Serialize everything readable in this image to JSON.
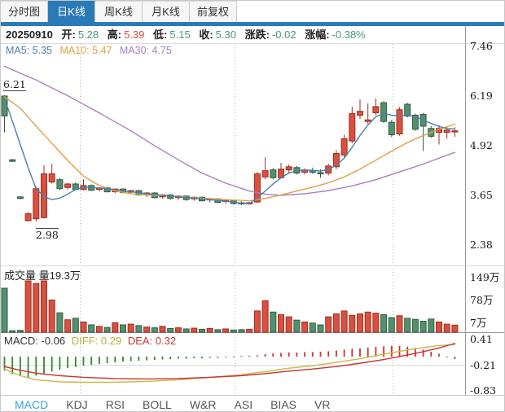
{
  "top_tabs": {
    "items": [
      {
        "label": "分时图",
        "selected": false
      },
      {
        "label": "日K线",
        "selected": true
      },
      {
        "label": "周K线",
        "selected": false
      },
      {
        "label": "月K线",
        "selected": false
      },
      {
        "label": "前复权",
        "selected": false
      }
    ]
  },
  "header": {
    "date": "20250910",
    "fields": [
      {
        "label": "开:",
        "value": "5.28",
        "color": "#459a80"
      },
      {
        "label": "高:",
        "value": "5.39",
        "color": "#e2493d"
      },
      {
        "label": "低:",
        "value": "5.15",
        "color": "#459a80"
      },
      {
        "label": "收:",
        "value": "5.30",
        "color": "#459a80"
      },
      {
        "label": "涨跌:",
        "value": "-0.02",
        "color": "#459a80"
      },
      {
        "label": "涨幅:",
        "value": "-0.38%",
        "color": "#459a80"
      }
    ]
  },
  "ma_row": {
    "items": [
      {
        "text": "MA5: 5.35",
        "color": "#4d7fad"
      },
      {
        "text": "MA10: 5.47",
        "color": "#e2a043"
      },
      {
        "text": "MA30: 4.75",
        "color": "#ab7fc0"
      }
    ]
  },
  "volume_panel": {
    "label": "成交量 量19.3万",
    "ticks": [
      "149万",
      "78万",
      "7万"
    ]
  },
  "macd_panel": {
    "items": [
      {
        "text": "MACD: -0.06",
        "color": "#333333"
      },
      {
        "text": "DIFF: 0.29",
        "color": "#bdae3e"
      },
      {
        "text": "DEA: 0.32",
        "color": "#cc3333"
      }
    ],
    "ticks": [
      "0.41",
      "-0.21",
      "-0.83"
    ]
  },
  "bottom_tabs": {
    "items": [
      "MACD",
      "KDJ",
      "RSI",
      "BOLL",
      "W&R",
      "ASI",
      "BIAS",
      "VR"
    ],
    "selected": 0
  },
  "chart_data": {
    "type": "candlestick",
    "title": "日K线 20250910",
    "price_axis": {
      "ticks": [
        "7.46",
        "6.19",
        "4.92",
        "3.65",
        "2.38"
      ],
      "values": [
        7.46,
        6.19,
        4.92,
        3.65,
        2.38
      ]
    },
    "annotations": {
      "high": "6.21",
      "low": "2.98"
    },
    "grid_x": [
      97,
      287,
      481
    ],
    "candles": [
      [
        6.19,
        6.21,
        5.26,
        5.68
      ],
      [
        4.56,
        4.58,
        4.5,
        4.52
      ],
      [
        3.61,
        3.63,
        3.55,
        3.57
      ],
      [
        3.0,
        3.22,
        2.98,
        3.18
      ],
      [
        3.05,
        3.88,
        2.98,
        3.82
      ],
      [
        3.08,
        4.42,
        3.05,
        4.2
      ],
      [
        3.99,
        4.46,
        3.95,
        4.2
      ],
      [
        4.05,
        4.1,
        3.78,
        3.82
      ],
      [
        3.85,
        3.97,
        3.8,
        3.94
      ],
      [
        3.94,
        3.98,
        3.78,
        3.8
      ],
      [
        3.8,
        4.06,
        3.78,
        3.9
      ],
      [
        3.9,
        3.93,
        3.76,
        3.78
      ],
      [
        3.8,
        3.86,
        3.75,
        3.84
      ],
      [
        3.84,
        3.87,
        3.72,
        3.74
      ],
      [
        3.74,
        3.83,
        3.71,
        3.81
      ],
      [
        3.81,
        3.83,
        3.7,
        3.72
      ],
      [
        3.73,
        3.79,
        3.68,
        3.77
      ],
      [
        3.77,
        3.79,
        3.64,
        3.66
      ],
      [
        3.68,
        3.73,
        3.6,
        3.71
      ],
      [
        3.71,
        3.73,
        3.57,
        3.59
      ],
      [
        3.61,
        3.68,
        3.57,
        3.66
      ],
      [
        3.66,
        3.68,
        3.54,
        3.57
      ],
      [
        3.59,
        3.65,
        3.53,
        3.63
      ],
      [
        3.63,
        3.65,
        3.51,
        3.54
      ],
      [
        3.56,
        3.62,
        3.51,
        3.6
      ],
      [
        3.6,
        3.62,
        3.49,
        3.51
      ],
      [
        3.53,
        3.58,
        3.47,
        3.56
      ],
      [
        3.56,
        3.58,
        3.45,
        3.47
      ],
      [
        3.49,
        3.54,
        3.43,
        3.52
      ],
      [
        3.52,
        3.54,
        3.41,
        3.44
      ],
      [
        3.46,
        3.5,
        3.4,
        3.43
      ],
      [
        3.44,
        3.48,
        3.41,
        3.46
      ],
      [
        3.48,
        4.25,
        3.45,
        4.2
      ],
      [
        4.12,
        4.62,
        4.06,
        4.28
      ],
      [
        4.3,
        4.35,
        4.06,
        4.1
      ],
      [
        4.1,
        4.48,
        4.08,
        4.32
      ],
      [
        4.3,
        4.44,
        4.22,
        4.38
      ],
      [
        4.36,
        4.4,
        4.18,
        4.22
      ],
      [
        4.24,
        4.34,
        4.18,
        4.3
      ],
      [
        4.28,
        4.36,
        4.2,
        4.24
      ],
      [
        4.23,
        4.32,
        4.1,
        4.2
      ],
      [
        4.22,
        4.46,
        4.16,
        4.4
      ],
      [
        4.38,
        4.8,
        4.32,
        4.72
      ],
      [
        4.68,
        5.2,
        4.62,
        5.1
      ],
      [
        5.04,
        5.92,
        4.98,
        5.74
      ],
      [
        5.7,
        6.1,
        5.6,
        5.8
      ],
      [
        5.54,
        6.0,
        5.48,
        5.58
      ],
      [
        5.76,
        6.13,
        5.7,
        5.92
      ],
      [
        6.02,
        6.06,
        5.5,
        5.54
      ],
      [
        5.52,
        5.58,
        5.14,
        5.2
      ],
      [
        5.22,
        5.9,
        5.18,
        5.84
      ],
      [
        5.98,
        6.02,
        5.64,
        5.68
      ],
      [
        5.7,
        5.74,
        5.3,
        5.34
      ],
      [
        5.72,
        5.76,
        4.78,
        5.42
      ],
      [
        5.36,
        5.42,
        5.12,
        5.16
      ],
      [
        5.26,
        5.45,
        4.95,
        5.36
      ],
      [
        5.26,
        5.42,
        5.1,
        5.32
      ],
      [
        5.28,
        5.39,
        5.15,
        5.3
      ]
    ],
    "volumes": [
      120,
      4,
      5,
      140,
      133,
      140,
      88,
      53,
      34,
      38,
      28,
      20,
      16,
      13,
      26,
      20,
      22,
      18,
      14,
      12,
      16,
      10,
      12,
      9,
      11,
      8,
      10,
      7,
      9,
      6,
      7,
      8,
      58,
      86,
      55,
      48,
      42,
      33,
      28,
      25,
      20,
      42,
      50,
      58,
      46,
      50,
      55,
      52,
      48,
      40,
      45,
      38,
      35,
      30,
      36,
      28,
      22,
      19.3
    ],
    "ma5_points": [
      [
        0,
        6.13
      ],
      [
        1,
        5.55
      ],
      [
        2,
        4.95
      ],
      [
        3,
        4.35
      ],
      [
        4,
        3.82
      ],
      [
        5,
        3.62
      ],
      [
        6,
        3.54
      ],
      [
        7,
        3.58
      ],
      [
        8,
        3.68
      ],
      [
        9,
        3.8
      ],
      [
        10,
        3.86
      ],
      [
        12,
        3.84
      ],
      [
        14,
        3.8
      ],
      [
        16,
        3.74
      ],
      [
        18,
        3.69
      ],
      [
        20,
        3.65
      ],
      [
        22,
        3.61
      ],
      [
        24,
        3.58
      ],
      [
        26,
        3.54
      ],
      [
        28,
        3.5
      ],
      [
        30,
        3.45
      ],
      [
        31,
        3.44
      ],
      [
        32,
        3.58
      ],
      [
        33,
        3.76
      ],
      [
        34,
        3.94
      ],
      [
        35,
        4.1
      ],
      [
        36,
        4.22
      ],
      [
        37,
        4.28
      ],
      [
        38,
        4.3
      ],
      [
        39,
        4.29
      ],
      [
        40,
        4.27
      ],
      [
        41,
        4.31
      ],
      [
        42,
        4.42
      ],
      [
        43,
        4.6
      ],
      [
        44,
        4.88
      ],
      [
        45,
        5.18
      ],
      [
        46,
        5.45
      ],
      [
        47,
        5.66
      ],
      [
        48,
        5.74
      ],
      [
        49,
        5.7
      ],
      [
        50,
        5.68
      ],
      [
        51,
        5.71
      ],
      [
        52,
        5.66
      ],
      [
        53,
        5.58
      ],
      [
        54,
        5.49
      ],
      [
        55,
        5.41
      ],
      [
        56,
        5.36
      ],
      [
        57,
        5.35
      ]
    ],
    "ma10_points": [
      [
        0,
        6.17
      ],
      [
        2,
        5.88
      ],
      [
        4,
        5.42
      ],
      [
        6,
        4.98
      ],
      [
        8,
        4.54
      ],
      [
        10,
        4.14
      ],
      [
        12,
        3.9
      ],
      [
        14,
        3.76
      ],
      [
        16,
        3.69
      ],
      [
        18,
        3.66
      ],
      [
        20,
        3.64
      ],
      [
        24,
        3.59
      ],
      [
        28,
        3.54
      ],
      [
        31,
        3.51
      ],
      [
        33,
        3.57
      ],
      [
        35,
        3.66
      ],
      [
        37,
        3.76
      ],
      [
        39,
        3.86
      ],
      [
        41,
        3.97
      ],
      [
        43,
        4.12
      ],
      [
        45,
        4.32
      ],
      [
        47,
        4.55
      ],
      [
        49,
        4.78
      ],
      [
        51,
        5.0
      ],
      [
        53,
        5.18
      ],
      [
        55,
        5.34
      ],
      [
        57,
        5.47
      ]
    ],
    "ma30_points": [
      [
        0,
        6.95
      ],
      [
        4,
        6.6
      ],
      [
        8,
        6.2
      ],
      [
        12,
        5.76
      ],
      [
        16,
        5.3
      ],
      [
        19,
        4.92
      ],
      [
        22,
        4.56
      ],
      [
        25,
        4.22
      ],
      [
        28,
        3.96
      ],
      [
        31,
        3.76
      ],
      [
        33,
        3.68
      ],
      [
        35,
        3.65
      ],
      [
        38,
        3.69
      ],
      [
        41,
        3.77
      ],
      [
        44,
        3.89
      ],
      [
        47,
        4.05
      ],
      [
        50,
        4.25
      ],
      [
        53,
        4.45
      ],
      [
        55,
        4.6
      ],
      [
        57,
        4.75
      ]
    ],
    "macd": {
      "hist": [
        -0.34,
        -0.42,
        -0.47,
        -0.5,
        -0.46,
        -0.41,
        -0.36,
        -0.32,
        -0.28,
        -0.25,
        -0.22,
        -0.2,
        -0.18,
        -0.16,
        -0.14,
        -0.12,
        -0.11,
        -0.1,
        -0.09,
        -0.08,
        -0.07,
        -0.06,
        -0.05,
        -0.05,
        -0.04,
        -0.04,
        -0.03,
        -0.03,
        -0.02,
        -0.01,
        0.01,
        0.01,
        0.03,
        0.06,
        0.08,
        0.09,
        0.1,
        0.1,
        0.11,
        0.11,
        0.12,
        0.13,
        0.15,
        0.17,
        0.19,
        0.2,
        0.22,
        0.24,
        0.25,
        0.26,
        0.26,
        0.24,
        0.21,
        0.17,
        0.12,
        0.07,
        -0.01,
        -0.06
      ],
      "diff_points": [
        [
          0,
          -0.3
        ],
        [
          2,
          -0.46
        ],
        [
          4,
          -0.56
        ],
        [
          7,
          -0.61
        ],
        [
          10,
          -0.62
        ],
        [
          14,
          -0.62
        ],
        [
          18,
          -0.6
        ],
        [
          22,
          -0.56
        ],
        [
          26,
          -0.5
        ],
        [
          30,
          -0.44
        ],
        [
          33,
          -0.36
        ],
        [
          36,
          -0.28
        ],
        [
          39,
          -0.22
        ],
        [
          42,
          -0.14
        ],
        [
          45,
          -0.05
        ],
        [
          48,
          0.06
        ],
        [
          51,
          0.16
        ],
        [
          53,
          0.22
        ],
        [
          55,
          0.27
        ],
        [
          57,
          0.29
        ]
      ],
      "dea_points": [
        [
          0,
          -0.24
        ],
        [
          2,
          -0.33
        ],
        [
          4,
          -0.4
        ],
        [
          7,
          -0.46
        ],
        [
          10,
          -0.5
        ],
        [
          14,
          -0.53
        ],
        [
          18,
          -0.54
        ],
        [
          22,
          -0.53
        ],
        [
          26,
          -0.5
        ],
        [
          30,
          -0.46
        ],
        [
          33,
          -0.41
        ],
        [
          36,
          -0.35
        ],
        [
          39,
          -0.3
        ],
        [
          42,
          -0.24
        ],
        [
          45,
          -0.16
        ],
        [
          48,
          -0.07
        ],
        [
          51,
          0.04
        ],
        [
          53,
          0.12
        ],
        [
          55,
          0.21
        ],
        [
          57,
          0.32
        ]
      ],
      "midline_value": -0.21
    },
    "colors": {
      "up_fill": "#d8503f",
      "up_stroke": "#9e2f20",
      "down_fill": "#55906c",
      "down_stroke": "#2e5d44",
      "ma5": "#4d7fad",
      "ma10": "#e2a043",
      "ma30": "#ab7fc0",
      "diff_line": "#c9b845",
      "dea_line": "#cc3333",
      "hist_pos": "#cc3333",
      "hist_neg": "#2e8b2e",
      "accent_blue": "#2b7ab8",
      "indicator_selected": "#3aa2d9"
    }
  }
}
